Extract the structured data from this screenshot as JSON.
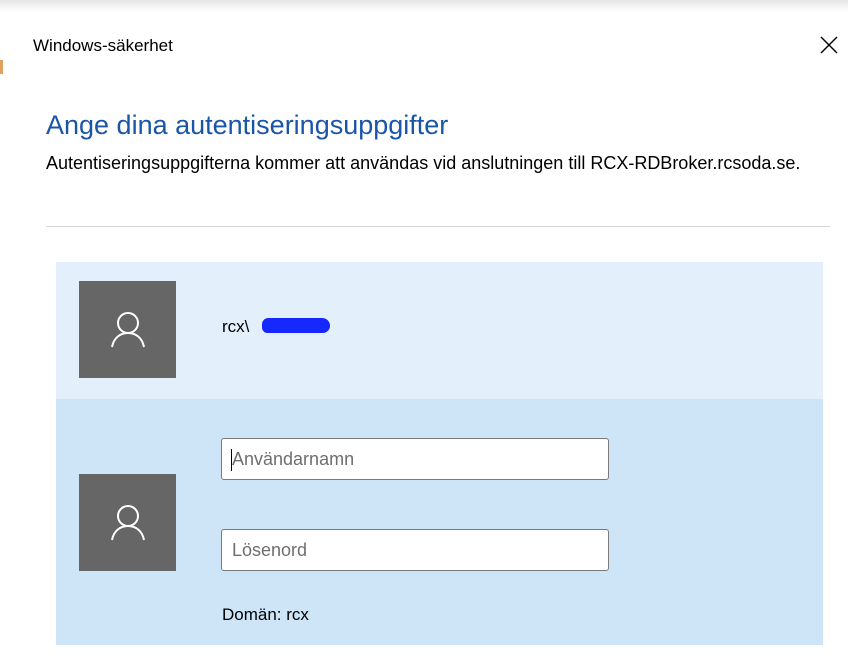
{
  "window": {
    "title": "Windows-säkerhet",
    "close_icon": "close-icon"
  },
  "prompt": {
    "heading": "Ange dina autentiseringsuppgifter",
    "description": "Autentiseringsuppgifterna kommer att användas vid anslutningen till RCX-RDBroker.rcsoda.se."
  },
  "accounts": {
    "remembered": {
      "username": "rcx\\",
      "avatar_icon": "user-icon"
    },
    "new_credentials": {
      "avatar_icon": "user-icon",
      "username_placeholder": "Användarnamn",
      "password_placeholder": "Lösenord",
      "domain_text": "Domän: rcx"
    }
  },
  "colors": {
    "heading": "#1a56a8",
    "tile_remembered": "#e3f0fb",
    "tile_selected": "#cde5f7",
    "avatar_bg": "#666666"
  }
}
